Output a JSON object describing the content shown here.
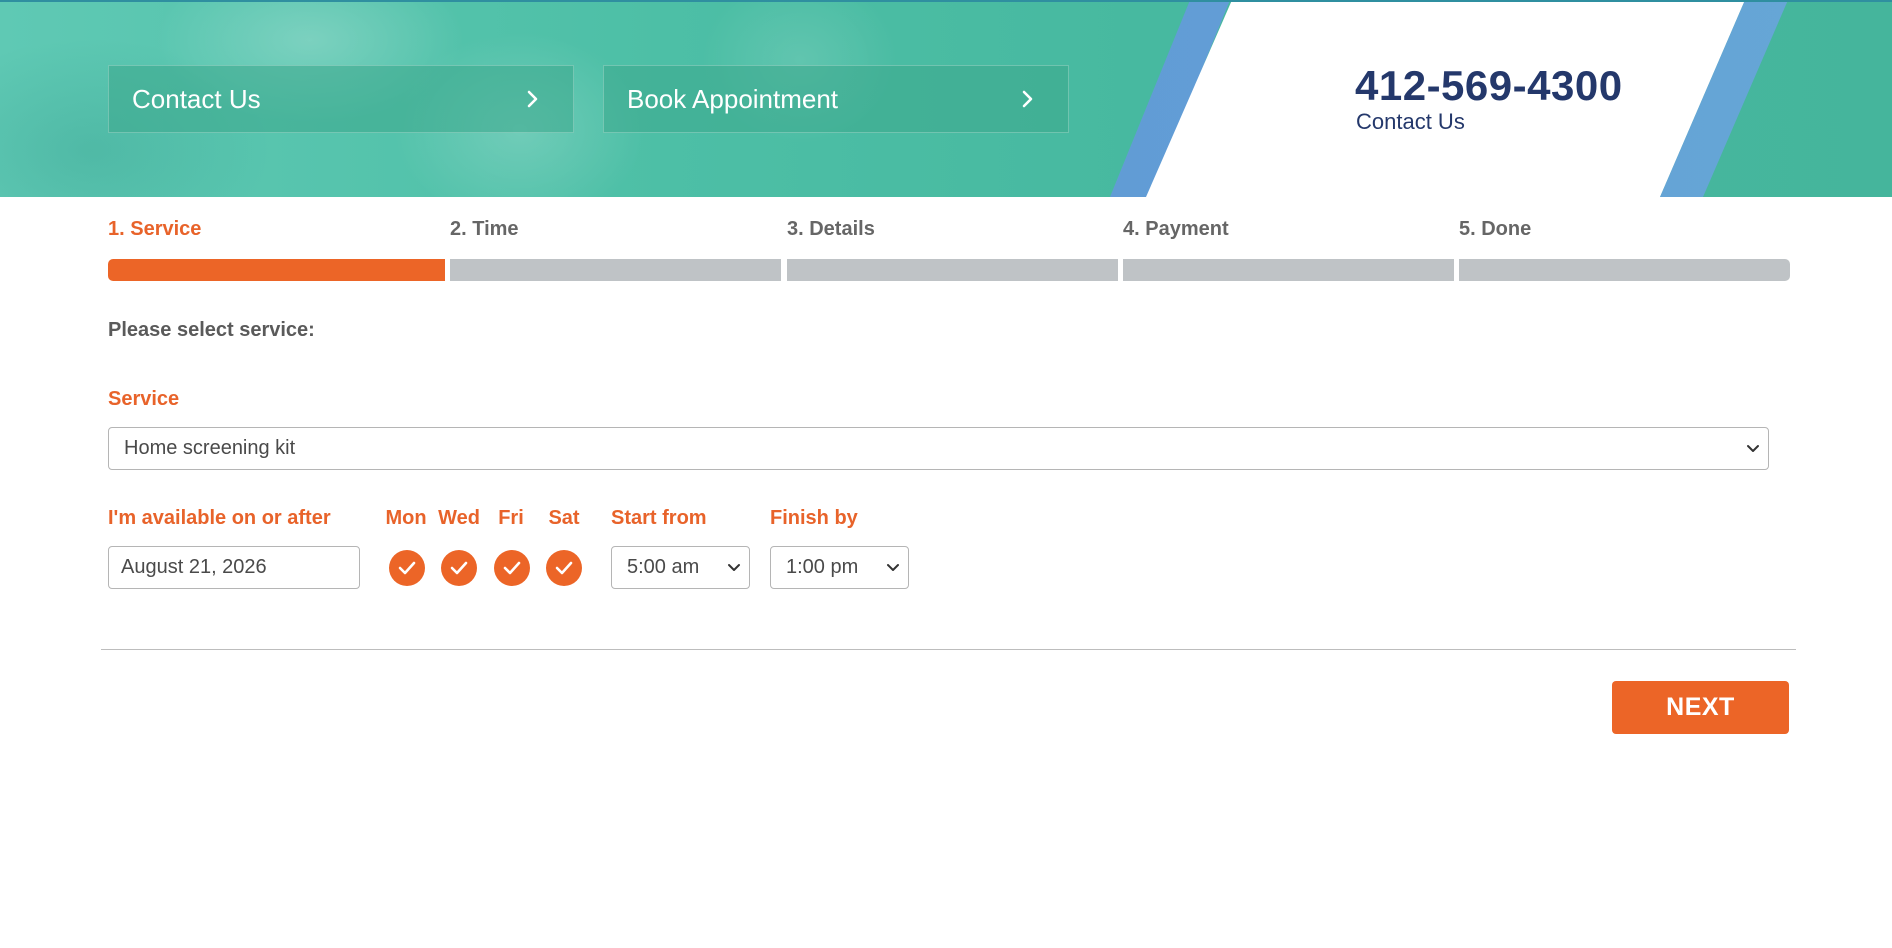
{
  "header": {
    "contact_label": "Contact Us",
    "book_label": "Book Appointment",
    "phone": "412-569-4300",
    "phone_sub": "Contact Us"
  },
  "steps": [
    {
      "label": "1. Service",
      "active": true
    },
    {
      "label": "2. Time",
      "active": false
    },
    {
      "label": "3. Details",
      "active": false
    },
    {
      "label": "4. Payment",
      "active": false
    },
    {
      "label": "5. Done",
      "active": false
    }
  ],
  "form": {
    "prompt": "Please select service:",
    "service_label": "Service",
    "service_value": "Home screening kit",
    "available_label": "I'm available on or after",
    "date_value": "August 21, 2026",
    "days": [
      {
        "label": "Mon",
        "checked": true
      },
      {
        "label": "Wed",
        "checked": true
      },
      {
        "label": "Fri",
        "checked": true
      },
      {
        "label": "Sat",
        "checked": true
      }
    ],
    "start_label": "Start from",
    "start_value": "5:00 am",
    "finish_label": "Finish by",
    "finish_value": "1:00 pm"
  },
  "actions": {
    "next_label": "NEXT"
  },
  "colors": {
    "accent": "#ec6527",
    "header_teal": "#4dbfa6",
    "phone_navy": "#24386b",
    "inactive_step": "#bfc3c6"
  }
}
